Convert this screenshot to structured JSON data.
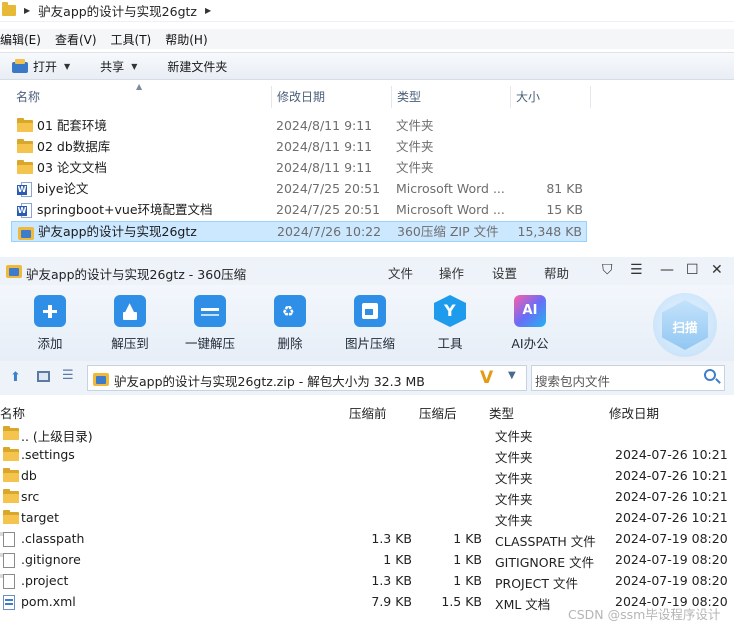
{
  "explorer": {
    "breadcrumb": "驴友app的设计与实现26gtz",
    "menu": [
      "编辑(E)",
      "查看(V)",
      "工具(T)",
      "帮助(H)"
    ],
    "toolbar": {
      "open": "打开",
      "share": "共享",
      "new_folder": "新建文件夹"
    },
    "columns": {
      "name": "名称",
      "date": "修改日期",
      "type": "类型",
      "size": "大小"
    },
    "rows": [
      {
        "name": "01 配套环境",
        "date": "2024/8/11 9:11",
        "type": "文件夹",
        "size": "",
        "icon": "folder-icon"
      },
      {
        "name": "02 db数据库",
        "date": "2024/8/11 9:11",
        "type": "文件夹",
        "size": "",
        "icon": "folder-icon"
      },
      {
        "name": "03 论文文档",
        "date": "2024/8/11 9:11",
        "type": "文件夹",
        "size": "",
        "icon": "folder-icon"
      },
      {
        "name": "biye论文",
        "date": "2024/7/25 20:51",
        "type": "Microsoft Word ...",
        "size": "81 KB",
        "icon": "word-document-icon"
      },
      {
        "name": "springboot+vue环境配置文档",
        "date": "2024/7/25 20:51",
        "type": "Microsoft Word ...",
        "size": "15 KB",
        "icon": "word-document-icon"
      },
      {
        "name": "驴友app的设计与实现26gtz",
        "date": "2024/7/26 10:22",
        "type": "360压缩 ZIP 文件",
        "size": "15,348 KB",
        "icon": "zip-archive-icon",
        "selected": true
      }
    ]
  },
  "zip": {
    "title": "驴友app的设计与实现26gtz - 360压缩",
    "menu": [
      "文件",
      "操作",
      "设置",
      "帮助"
    ],
    "tools": [
      {
        "label": "添加",
        "icon": "add-icon",
        "color": "#2f8fe6"
      },
      {
        "label": "解压到",
        "icon": "extract-to-icon",
        "color": "#2f8fe6"
      },
      {
        "label": "一键解压",
        "icon": "one-click-extract-icon",
        "color": "#2f8fe6"
      },
      {
        "label": "删除",
        "icon": "delete-icon",
        "color": "#2f8fe6"
      },
      {
        "label": "图片压缩",
        "icon": "image-compress-icon",
        "color": "#2f8fe6"
      },
      {
        "label": "工具",
        "icon": "tools-icon",
        "color": "#1f9bee"
      },
      {
        "label": "AI办公",
        "icon": "ai-office-icon",
        "color": "#7a5cf0"
      }
    ],
    "scan_label": "扫描",
    "address": "驴友app的设计与实现26gtz.zip - 解包大小为 32.3 MB",
    "search_placeholder": "搜索包内文件",
    "columns": {
      "name": "名称",
      "packed": "压缩前",
      "compressed": "压缩后",
      "type": "类型",
      "date": "修改日期"
    },
    "rows": [
      {
        "name": ".. (上级目录)",
        "packed": "",
        "compressed": "",
        "type": "文件夹",
        "date": "",
        "icon": "folder-icon"
      },
      {
        "name": ".settings",
        "packed": "",
        "compressed": "",
        "type": "文件夹",
        "date": "2024-07-26 10:21",
        "icon": "folder-icon"
      },
      {
        "name": "db",
        "packed": "",
        "compressed": "",
        "type": "文件夹",
        "date": "2024-07-26 10:21",
        "icon": "folder-icon"
      },
      {
        "name": "src",
        "packed": "",
        "compressed": "",
        "type": "文件夹",
        "date": "2024-07-26 10:21",
        "icon": "folder-icon"
      },
      {
        "name": "target",
        "packed": "",
        "compressed": "",
        "type": "文件夹",
        "date": "2024-07-26 10:21",
        "icon": "folder-icon"
      },
      {
        "name": ".classpath",
        "packed": "1.3 KB",
        "compressed": "1 KB",
        "type": "CLASSPATH 文件",
        "date": "2024-07-19 08:20",
        "icon": "file-icon"
      },
      {
        "name": ".gitignore",
        "packed": "1 KB",
        "compressed": "1 KB",
        "type": "GITIGNORE 文件",
        "date": "2024-07-19 08:20",
        "icon": "file-icon"
      },
      {
        "name": ".project",
        "packed": "1.3 KB",
        "compressed": "1 KB",
        "type": "PROJECT 文件",
        "date": "2024-07-19 08:20",
        "icon": "file-icon"
      },
      {
        "name": "pom.xml",
        "packed": "7.9 KB",
        "compressed": "1.5 KB",
        "type": "XML 文档",
        "date": "2024-07-19 08:20",
        "icon": "xml-file-icon"
      }
    ]
  },
  "watermark": "CSDN @ssm毕设程序设计"
}
